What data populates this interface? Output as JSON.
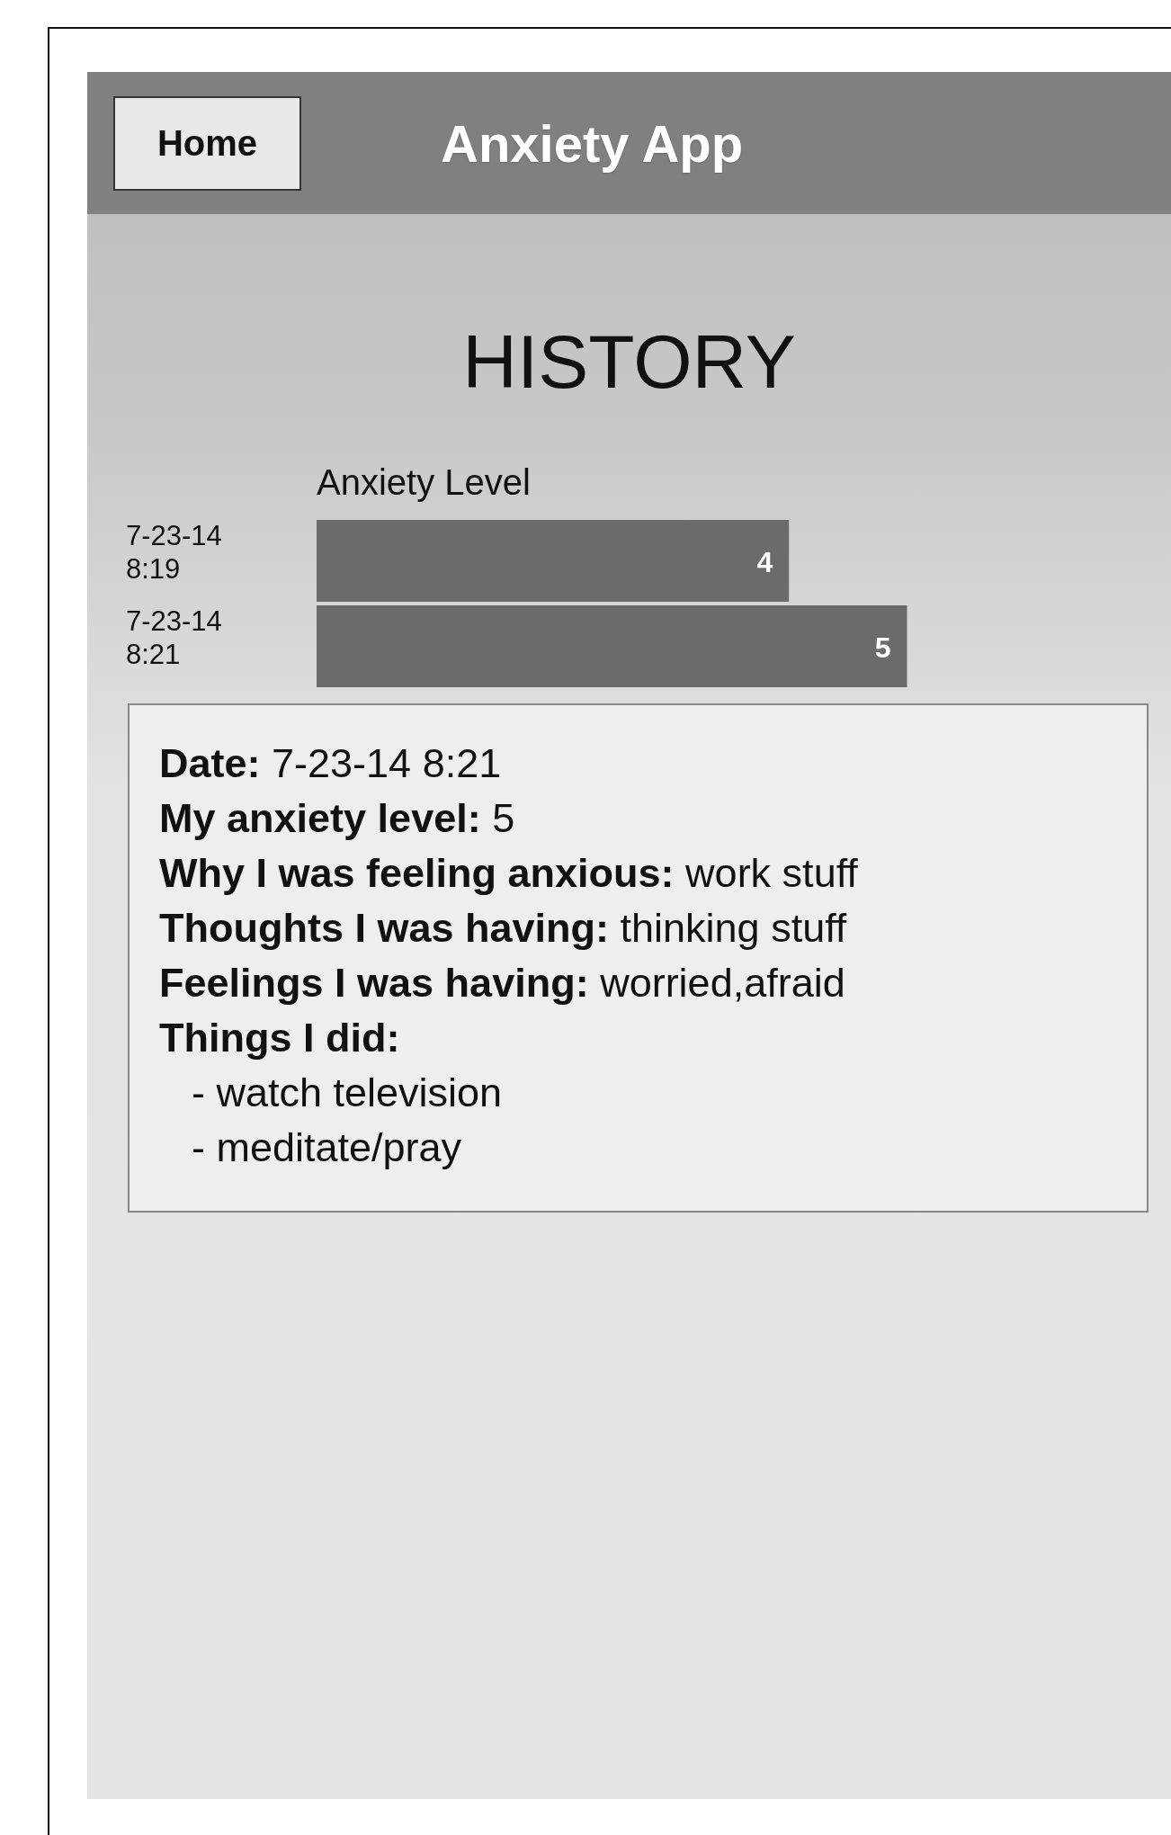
{
  "header": {
    "home_button": "Home",
    "title": "Anxiety App"
  },
  "page_title": "HISTORY",
  "chart_data": {
    "type": "bar",
    "orientation": "horizontal",
    "title": "Anxiety Level",
    "categories": [
      "7-23-14 8:19",
      "7-23-14 8:21"
    ],
    "values": [
      4,
      5
    ],
    "data_labels": true
  },
  "entry": {
    "fields": [
      {
        "label": "Date:",
        "value": "7-23-14 8:21"
      },
      {
        "label": "My anxiety level:",
        "value": "5"
      },
      {
        "label": "Why I was feeling anxious:",
        "value": "work stuff"
      },
      {
        "label": "Thoughts I was having:",
        "value": "thinking stuff"
      },
      {
        "label": "Feelings I was having:",
        "value": "worried,afraid"
      }
    ],
    "things_label": "Things I did:",
    "things": [
      "- watch television",
      "- meditate/pray"
    ]
  }
}
